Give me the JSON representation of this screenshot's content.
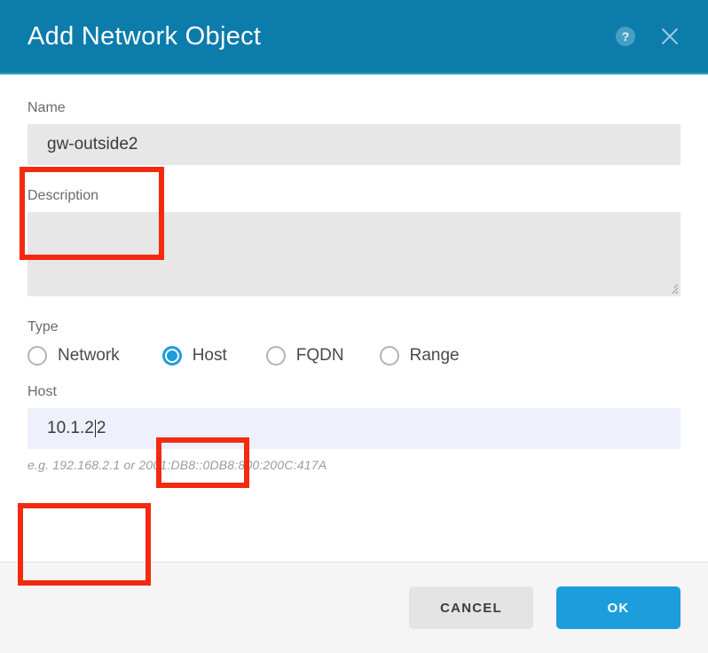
{
  "header": {
    "title": "Add Network Object",
    "help_icon": "help-circle-icon",
    "help_glyph": "?",
    "close_icon": "close-icon"
  },
  "form": {
    "name": {
      "label": "Name",
      "value": "gw-outside2",
      "placeholder": ""
    },
    "description": {
      "label": "Description",
      "value": "",
      "placeholder": ""
    },
    "type": {
      "label": "Type",
      "selected": "Host",
      "options": [
        {
          "label": "Network",
          "selected": false
        },
        {
          "label": "Host",
          "selected": true
        },
        {
          "label": "FQDN",
          "selected": false
        },
        {
          "label": "Range",
          "selected": false
        }
      ]
    },
    "host": {
      "label": "Host",
      "value_before_caret": "10.1.2",
      "value_after_caret": "2",
      "value": "10.1.22",
      "hint": "e.g. 192.168.2.1 or 2001:DB8::0DB8:800:200C:417A"
    }
  },
  "footer": {
    "cancel_label": "CANCEL",
    "ok_label": "OK"
  },
  "colors": {
    "header_blue": "#0c7cab",
    "accent_blue": "#1d9ddb",
    "annotation_red": "#f22a10",
    "input_gray": "#e7e7e7",
    "input_focus": "#eef1fb",
    "footer_gray": "#f5f5f5"
  }
}
